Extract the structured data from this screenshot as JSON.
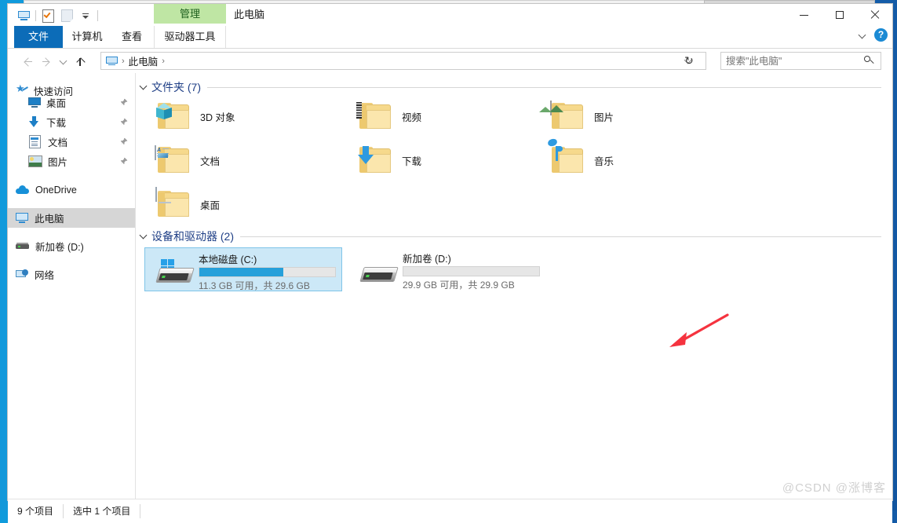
{
  "window": {
    "title": "此电脑",
    "contextual_tab": "管理",
    "controls": {
      "minimize": "—",
      "maximize": "□",
      "close": "✕"
    },
    "quick_access": [
      "this-pc-icon",
      "properties-icon",
      "new-folder-icon",
      "customize-dropdown-icon"
    ]
  },
  "ribbon": {
    "tabs": [
      {
        "label": "文件",
        "active": true
      },
      {
        "label": "计算机",
        "active": false
      },
      {
        "label": "查看",
        "active": false
      },
      {
        "label": "驱动器工具",
        "active": false
      }
    ],
    "collapse_icon": "chevron-down-icon",
    "help_icon": "?"
  },
  "addressbar": {
    "back": "back-arrow-icon",
    "forward": "forward-arrow-icon",
    "recent": "history-dropdown-icon",
    "up": "up-arrow-icon",
    "breadcrumb": {
      "root_icon": "this-pc-icon",
      "items": [
        "此电脑"
      ],
      "separator": "›"
    },
    "dropdown": "chevron-down-icon",
    "refresh": "↻",
    "search": {
      "placeholder": "搜索\"此电脑\"",
      "value": "",
      "icon": "search-icon"
    }
  },
  "sidebar": {
    "items": [
      {
        "label": "快速访问",
        "icon": "star-pin-icon",
        "indent": 10,
        "pinned": false,
        "selected": false
      },
      {
        "label": "桌面",
        "icon": "desktop-icon",
        "indent": 26,
        "pinned": true,
        "selected": false
      },
      {
        "label": "下载",
        "icon": "download-icon",
        "indent": 26,
        "pinned": true,
        "selected": false
      },
      {
        "label": "文档",
        "icon": "documents-icon",
        "indent": 26,
        "pinned": true,
        "selected": false
      },
      {
        "label": "图片",
        "icon": "pictures-icon",
        "indent": 26,
        "pinned": true,
        "selected": false
      },
      {
        "label": "OneDrive",
        "icon": "cloud-icon",
        "indent": 10,
        "pinned": false,
        "selected": false
      },
      {
        "label": "此电脑",
        "icon": "this-pc-icon",
        "indent": 10,
        "pinned": false,
        "selected": true
      },
      {
        "label": "新加卷 (D:)",
        "icon": "drive-icon",
        "indent": 10,
        "pinned": false,
        "selected": false
      },
      {
        "label": "网络",
        "icon": "network-icon",
        "indent": 10,
        "pinned": false,
        "selected": false
      }
    ]
  },
  "content": {
    "sections": [
      {
        "title": "文件夹 (7)",
        "chevron": "chevron-down-icon"
      },
      {
        "title": "设备和驱动器 (2)",
        "chevron": "chevron-down-icon"
      }
    ],
    "folders": [
      {
        "label": "3D 对象",
        "icon": "3d-object-folder-icon",
        "col": 0,
        "row": 0
      },
      {
        "label": "视频",
        "icon": "videos-folder-icon",
        "col": 1,
        "row": 0
      },
      {
        "label": "图片",
        "icon": "pictures-folder-icon",
        "col": 2,
        "row": 0
      },
      {
        "label": "文档",
        "icon": "documents-folder-icon",
        "col": 0,
        "row": 1
      },
      {
        "label": "下载",
        "icon": "downloads-folder-icon",
        "col": 1,
        "row": 1
      },
      {
        "label": "音乐",
        "icon": "music-folder-icon",
        "col": 2,
        "row": 1
      },
      {
        "label": "桌面",
        "icon": "desktop-folder-icon",
        "col": 0,
        "row": 2
      }
    ],
    "drives": [
      {
        "name": "本地磁盘 (C:)",
        "capacity_text": "11.3 GB 可用，共 29.6 GB",
        "free_gb": 11.3,
        "total_gb": 29.6,
        "used_percent": 62,
        "selected": true,
        "icon": "windows-drive-icon"
      },
      {
        "name": "新加卷 (D:)",
        "capacity_text": "29.9 GB 可用，共 29.9 GB",
        "free_gb": 29.9,
        "total_gb": 29.9,
        "used_percent": 0,
        "selected": false,
        "icon": "drive-icon"
      }
    ]
  },
  "status": {
    "item_count": "9 个项目",
    "selection": "选中 1 个项目"
  },
  "annotation": {
    "arrow_color": "#f5333f"
  },
  "watermark": {
    "text": "@CSDN @涨博客"
  },
  "colors": {
    "accent": "#0c6cb8",
    "contextual_tab": "#bfe6a4",
    "selection": "#cce8f7",
    "progress": "#26a0da",
    "section_title": "#1f3f86"
  }
}
